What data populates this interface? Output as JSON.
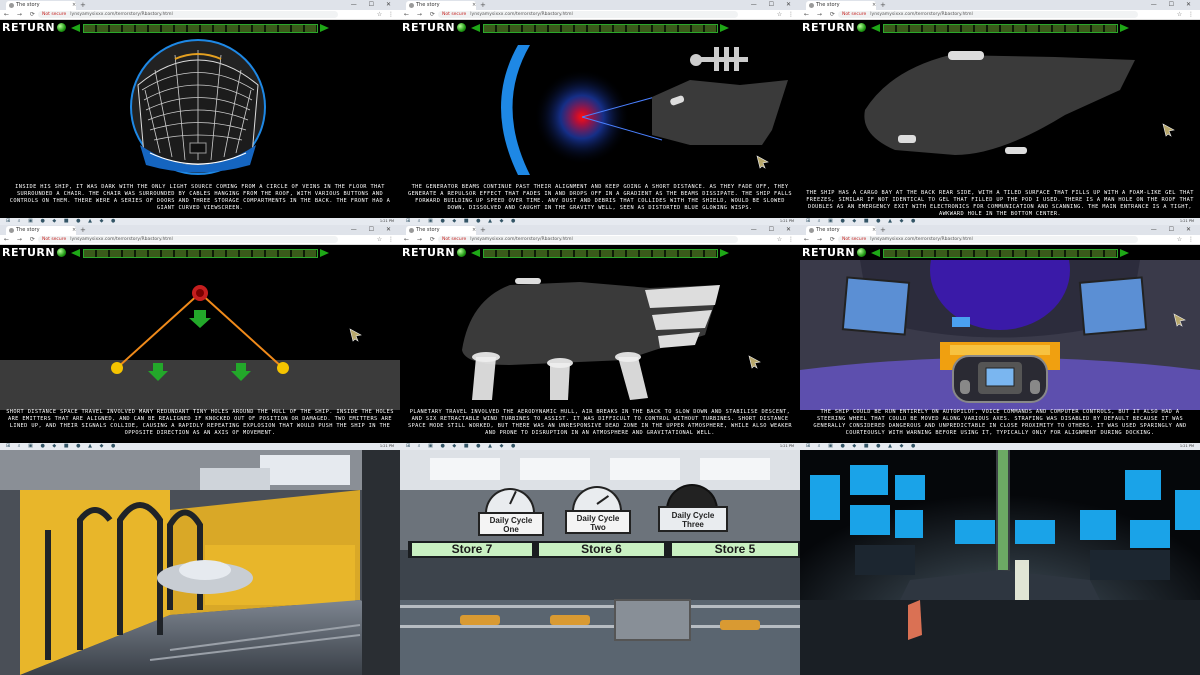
{
  "browser": {
    "tab_title": "The story",
    "not_secure": "Not secure",
    "url": "lynsyamysixxx.com/terrorstory/Rbastory.html",
    "nav_icons": "← → ⟳",
    "window_buttons": "— ☐ ✕",
    "ext_icons": "☆ ⋮",
    "tab_close": "×",
    "new_tab": "+"
  },
  "game": {
    "return_label": "RETURN"
  },
  "taskbar": {
    "icons": "⊞ ⌕ ▣ ● ◆ ■ ● ▲ ◆ ●",
    "clock": "1:21 PM"
  },
  "panels": [
    {
      "caption": "Inside his ship, it was dark with the only light source coming from a circle of veins in the floor that surrounded a chair. The chair was surrounded by cables hanging from the roof, with various buttons and controls on them. There were a series of doors and three storage compartments in the back. The front had a giant curved viewscreen."
    },
    {
      "caption": "The generator beams continue past their alignment and keep going a short distance. As they fade off, they generate a repulsor effect that fades in and drops off in a gradient as the beams dissipate. The ship falls forward building up speed over time. Any dust and debris that collides with the shield, would be slowed down, dissolved and caught in the gravity well, seen as distorted blue glowing wisps."
    },
    {
      "caption": "The ship has a cargo bay at the back rear side, with a tiled surface that fills up with a foam-like gel that freezes, similar if not identical to gel that filled up the pod I used. There is a man hole on the roof that doubles as an emergency exit with electronics for communication and scanning. The main entrance is a tight, awkward hole in the bottom center."
    },
    {
      "caption": "Short distance space travel involved many redundant tiny holes around the hull of the ship. Inside the holes are emitters that are aligned, and can be realigned if knocked out of position or damaged. Two emitters are lined up, and their signals collide, causing a rapidly repeating explosion that would push the ship in the opposite direction as an axis of movement."
    },
    {
      "caption": "Planetary travel involved the aerodynamic hull, air breaks in the back to slow down and stabilise descent, and six retractable wind turbines to assist. It was difficult to control without turbines. Short distance space mode still worked, but there was an unresponsive dead zone in the upper atmosphere, while also weaker and prone to disruption in an atmosphere and gravitational well."
    },
    {
      "caption": "The ship could be run entirely on autopilot, voice commands and computer controls, but it also had a steering wheel that could be moved along various axes. Strafing was disabled by default because it was generally considered dangerous and unpredictable in close proximity to others. It was used sparingly and courteously with warning before using it, typically only for alignment during docking."
    }
  ],
  "scene_store": {
    "cycles": [
      "Daily Cycle One",
      "Daily Cycle Two",
      "Daily Cycle Three"
    ],
    "stores": [
      "Store 7",
      "Store 6",
      "Store 5"
    ]
  },
  "colors": {
    "accent_green": "#1ea817",
    "return_text": "#ffffff",
    "caption_text": "#ffffff",
    "ship_gray": "#3a3a3a",
    "beam_orange": "#f08a1a",
    "station_yellow": "#e8b62a",
    "store_green": "#c9f0c2"
  }
}
